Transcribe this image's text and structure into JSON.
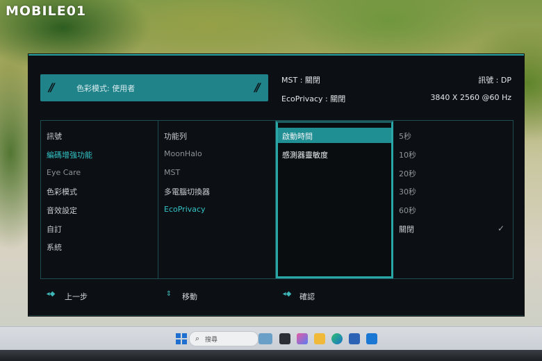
{
  "watermark": {
    "brand": "MOBILE01"
  },
  "osd": {
    "color_mode_label": "色彩模式: 使用者",
    "mst_status": "MST : 關閉",
    "signal_status": "訊號 : DP",
    "ecoprivacy_status": "EcoPrivacy : 關閉",
    "resolution": "3840 X 2560 @60 Hz",
    "menu_main": [
      {
        "label": "訊號",
        "state": "normal"
      },
      {
        "label": "編碼增強功能",
        "state": "active"
      },
      {
        "label": "Eye Care",
        "state": "dim"
      },
      {
        "label": "色彩模式",
        "state": "normal"
      },
      {
        "label": "音效設定",
        "state": "normal"
      },
      {
        "label": "自訂",
        "state": "normal"
      },
      {
        "label": "系統",
        "state": "normal"
      }
    ],
    "menu_features": [
      {
        "label": "功能列",
        "state": "normal"
      },
      {
        "label": "MoonHalo",
        "state": "dim"
      },
      {
        "label": "MST",
        "state": "dim"
      },
      {
        "label": "多電腦切換器",
        "state": "normal"
      },
      {
        "label": "EcoPrivacy",
        "state": "active"
      }
    ],
    "menu_ecoprivacy": [
      {
        "label": "啟動時間",
        "selected": true
      },
      {
        "label": "感測器靈敏度",
        "selected": false
      }
    ],
    "menu_options": [
      {
        "label": "5秒",
        "checked": false
      },
      {
        "label": "10秒",
        "checked": false
      },
      {
        "label": "20秒",
        "checked": false
      },
      {
        "label": "30秒",
        "checked": false
      },
      {
        "label": "60秒",
        "checked": false
      },
      {
        "label": "關閉",
        "checked": true
      }
    ],
    "footer": {
      "back_label": "上一步",
      "move_label": "移動",
      "confirm_label": "確認"
    }
  },
  "taskbar": {
    "search_placeholder": "搜尋"
  },
  "colors": {
    "accent": "#29a6a6",
    "panel_bg": "#0c1014"
  }
}
